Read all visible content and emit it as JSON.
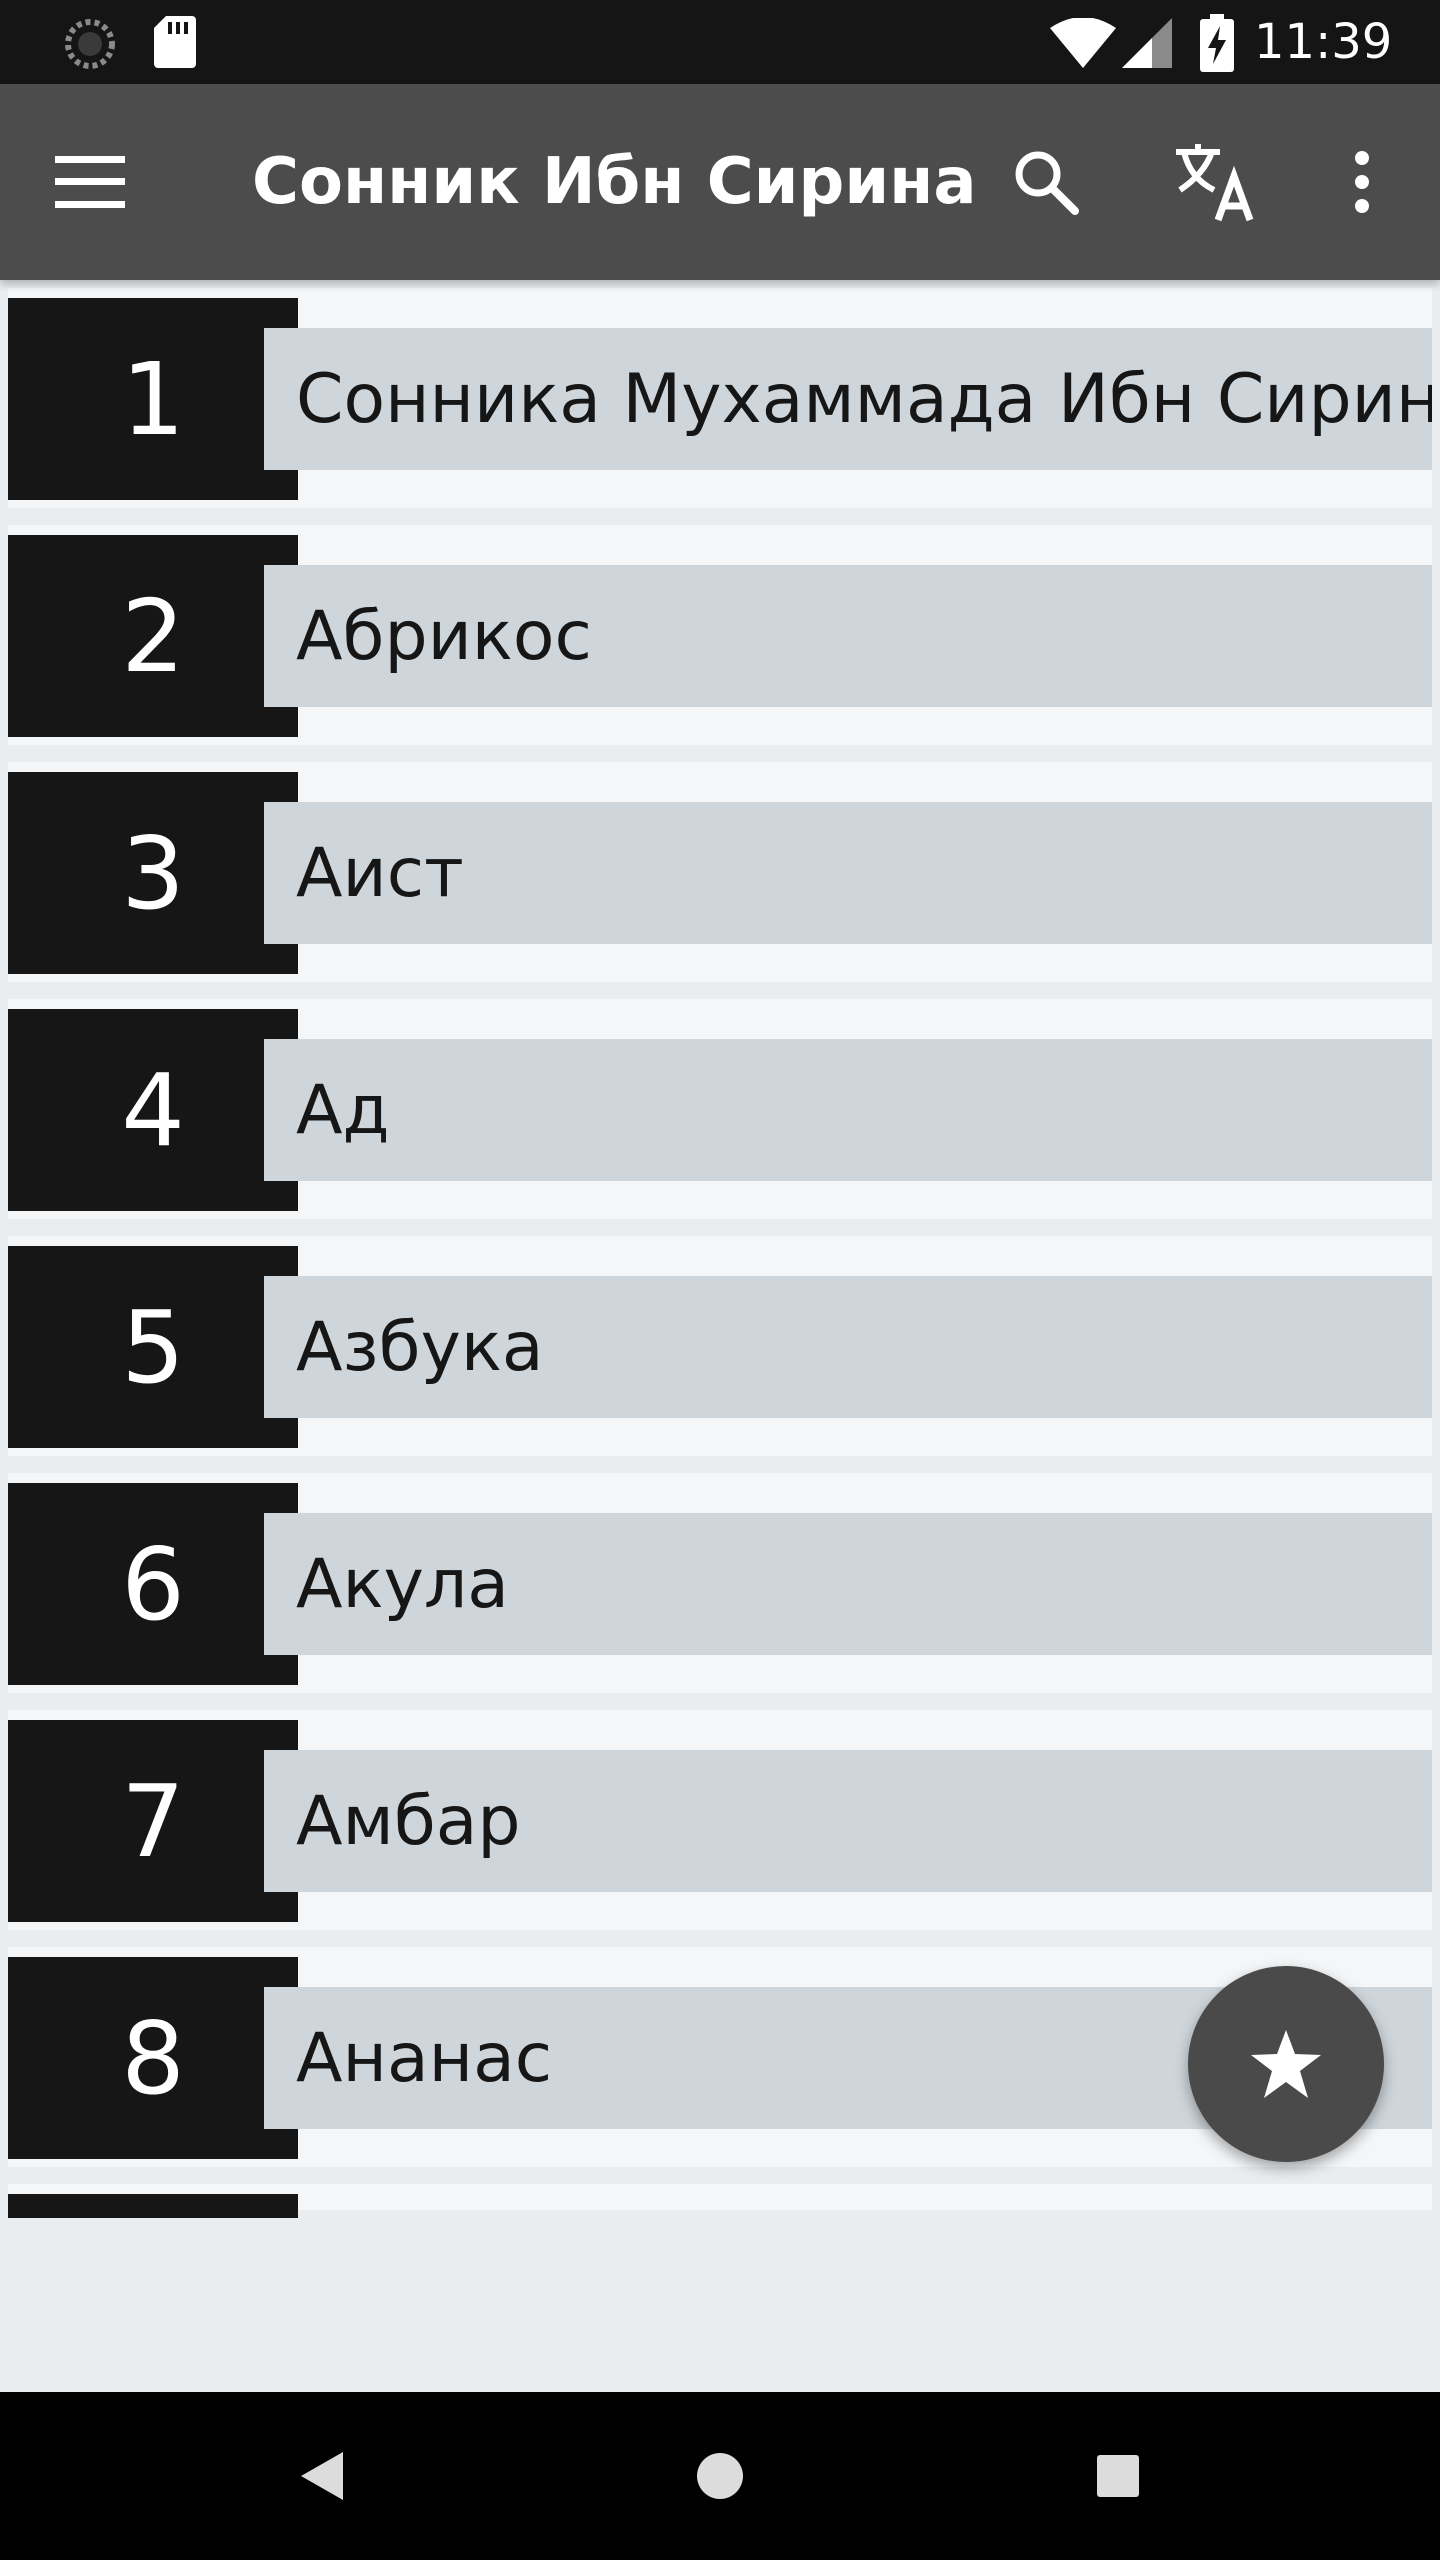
{
  "status_bar": {
    "time": "11:39",
    "icons": [
      "loading-icon",
      "sd-card-icon",
      "wifi-icon",
      "signal-icon",
      "battery-charging-icon"
    ]
  },
  "app_bar": {
    "title": "Сонник Ибн Сирина",
    "icons": [
      "menu-icon",
      "search-icon",
      "translate-icon",
      "more-vert-icon"
    ]
  },
  "list": {
    "items": [
      {
        "number": "1",
        "label": "Сонника Мухаммада Ибн Сирина"
      },
      {
        "number": "2",
        "label": "Абрикос"
      },
      {
        "number": "3",
        "label": "Аист"
      },
      {
        "number": "4",
        "label": "Ад"
      },
      {
        "number": "5",
        "label": "Азбука"
      },
      {
        "number": "6",
        "label": "Акула"
      },
      {
        "number": "7",
        "label": "Амбар"
      },
      {
        "number": "8",
        "label": "Ананас"
      }
    ]
  },
  "fab": {
    "icon": "star-icon"
  },
  "nav_bar": {
    "icons": [
      "back-icon",
      "home-icon",
      "recents-icon"
    ]
  },
  "colors": {
    "status_bar": "#151515",
    "app_bar": "#4c4c4c",
    "number_box": "#161616",
    "label_box": "#cfd6db",
    "background": "#e9edf0",
    "fab": "#4a4a4a"
  }
}
